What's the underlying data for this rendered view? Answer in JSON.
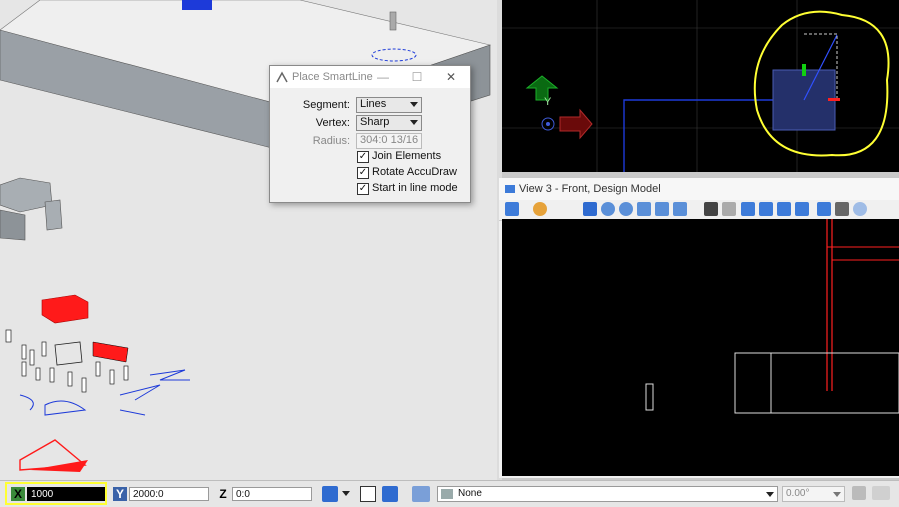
{
  "dialog": {
    "title": "Place SmartLine",
    "minimize_glyph": "—",
    "maximize_glyph": "☐",
    "close_glyph": "✕",
    "segment_label": "Segment:",
    "segment_value": "Lines",
    "vertex_label": "Vertex:",
    "vertex_value": "Sharp",
    "radius_label": "Radius:",
    "radius_value": "304:0 13/16",
    "join_elements": "Join Elements",
    "rotate_accudraw": "Rotate AccuDraw",
    "start_in_line_mode": "Start in line mode",
    "check_glyph": "✓"
  },
  "view3": {
    "title": "View 3 - Front, Design Model"
  },
  "accudraw": {
    "y_label": "Y"
  },
  "statusbar": {
    "x_label": "X",
    "x_value": "1000",
    "y_label": "Y",
    "y_value": "2000:0",
    "z_label": "Z",
    "z_value": "0:0",
    "level_value": "None",
    "angle_value": "0.00°"
  },
  "colors": {
    "highlight_yellow": "#ffff33",
    "x_badge": "#3a8a3a",
    "y_badge": "#3a62a8"
  }
}
